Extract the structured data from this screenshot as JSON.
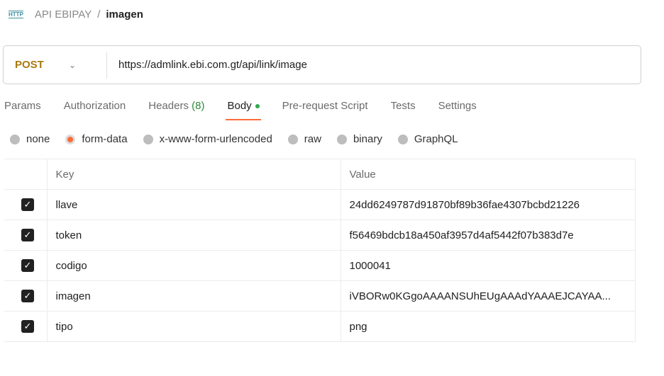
{
  "breadcrumb": {
    "icon": "http-icon",
    "collection": "API EBIPAY",
    "separator": "/",
    "request": "imagen"
  },
  "request": {
    "method": "POST",
    "url": "https://admlink.ebi.com.gt/api/link/image"
  },
  "tabs": [
    {
      "label": "Params"
    },
    {
      "label": "Authorization"
    },
    {
      "label": "Headers",
      "count": "(8)"
    },
    {
      "label": "Body",
      "active": true
    },
    {
      "label": "Pre-request Script"
    },
    {
      "label": "Tests"
    },
    {
      "label": "Settings"
    }
  ],
  "body_modes": [
    {
      "label": "none"
    },
    {
      "label": "form-data",
      "selected": true
    },
    {
      "label": "x-www-form-urlencoded"
    },
    {
      "label": "raw"
    },
    {
      "label": "binary"
    },
    {
      "label": "GraphQL"
    }
  ],
  "table": {
    "headers": {
      "key": "Key",
      "value": "Value"
    },
    "rows": [
      {
        "checked": true,
        "key": "llave",
        "value": "24dd6249787d91870bf89b36fae4307bcbd21226"
      },
      {
        "checked": true,
        "key": "token",
        "value": "f56469bdcb18a450af3957d4af5442f07b383d7e"
      },
      {
        "checked": true,
        "key": "codigo",
        "value": "1000041"
      },
      {
        "checked": true,
        "key": "imagen",
        "value": "iVBORw0KGgoAAAANSUhEUgAAAdYAAAEJCAYAA..."
      },
      {
        "checked": true,
        "key": "tipo",
        "value": "png"
      }
    ]
  },
  "colors": {
    "accent": "#ff6c37",
    "method": "#a87a10",
    "count": "#2f8a3b"
  }
}
